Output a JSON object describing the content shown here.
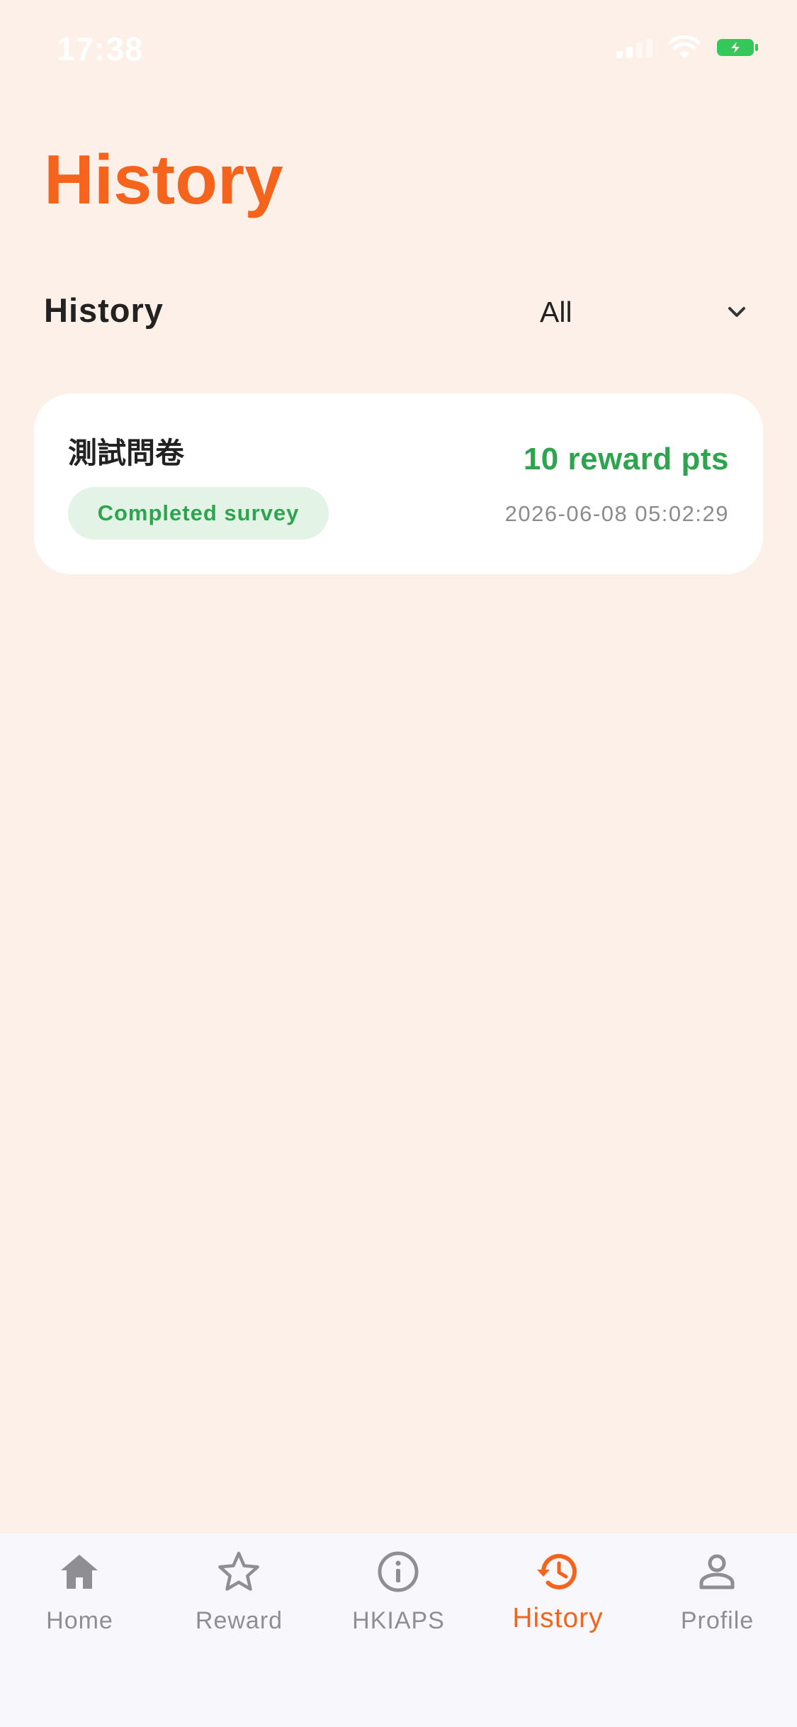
{
  "status_bar": {
    "time": "17:38"
  },
  "header": {
    "title": "History"
  },
  "filter": {
    "section_label": "History",
    "selected_value": "All"
  },
  "history_items": [
    {
      "title": "測試問卷",
      "status": "Completed survey",
      "points": "10 reward pts",
      "date": "2026-06-08 05:02:29"
    }
  ],
  "tabs": [
    {
      "label": "Home",
      "icon": "home-icon",
      "active": false
    },
    {
      "label": "Reward",
      "icon": "star-icon",
      "active": false
    },
    {
      "label": "HKIAPS",
      "icon": "info-icon",
      "active": false
    },
    {
      "label": "History",
      "icon": "history-icon",
      "active": true
    },
    {
      "label": "Profile",
      "icon": "person-icon",
      "active": false
    }
  ],
  "colors": {
    "accent": "#f4641c",
    "background": "#fdf0e8",
    "success": "#2ea44f",
    "success_bg": "#e3f4e6",
    "tab_inactive": "#8e8e93",
    "tab_bar_bg": "#f8f8fc"
  }
}
